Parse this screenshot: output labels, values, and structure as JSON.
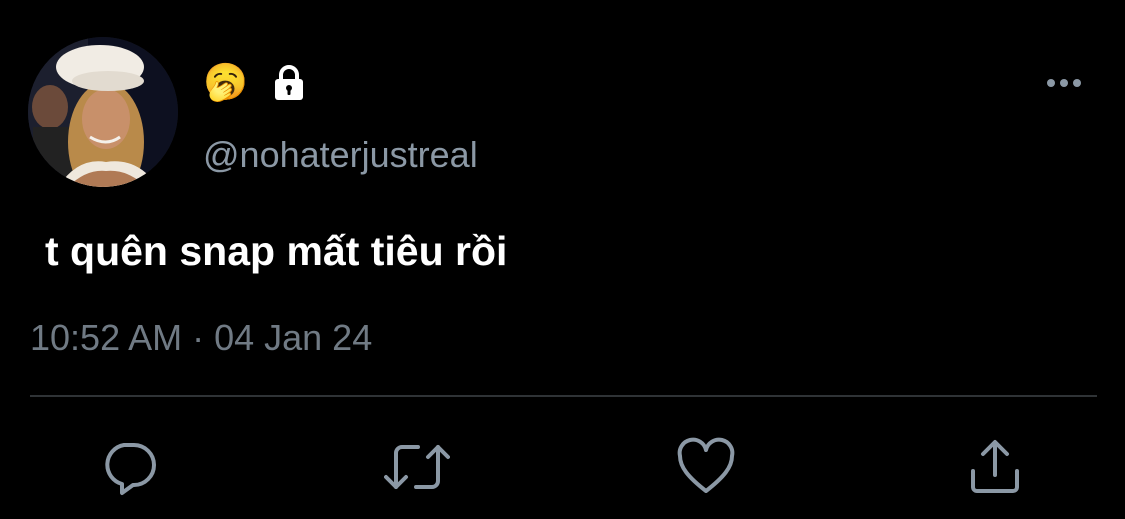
{
  "author": {
    "emoji": "🥱",
    "handle": "@nohaterjustreal",
    "locked": true
  },
  "tweet": {
    "text": "t quên snap mất tiêu rồi",
    "timestamp": "10:52 AM · 04 Jan 24"
  },
  "actions": {
    "reply_icon": "reply-icon",
    "retweet_icon": "retweet-icon",
    "like_icon": "heart-icon",
    "share_icon": "share-icon"
  },
  "colors": {
    "background": "#000000",
    "text": "#ffffff",
    "secondary_text": "#8b98a5",
    "icon": "#8b98a5",
    "divider": "#2f3336"
  }
}
